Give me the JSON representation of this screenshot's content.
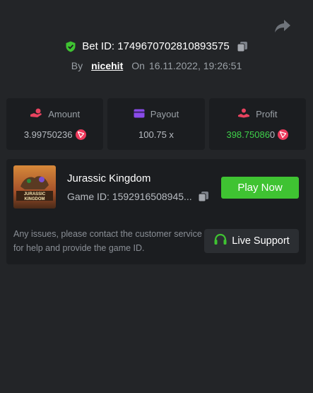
{
  "header": {
    "bet_id_label": "Bet ID:",
    "bet_id": "1749670702810893575",
    "by_label": "By",
    "username": "nicehit",
    "on_label": "On",
    "datetime": "16.11.2022, 19:26:51"
  },
  "stats": {
    "amount": {
      "label": "Amount",
      "value": "3.99750236",
      "icon": "coins-hand-icon",
      "currency_icon": "trx-icon"
    },
    "payout": {
      "label": "Payout",
      "value": "100.75 x",
      "icon": "card-icon"
    },
    "profit": {
      "label": "Profit",
      "value_main": "398.75086",
      "value_tail": "0",
      "icon": "user-hand-icon",
      "currency_icon": "trx-icon"
    }
  },
  "game": {
    "title": "Jurassic Kingdom",
    "id_label": "Game ID:",
    "id_value": "1592916508945...",
    "play_label": "Play Now",
    "thumbnail_text": "JURASSIC KINGDOM"
  },
  "support": {
    "text": "Any issues, please contact the customer service for help and provide the game ID.",
    "button_label": "Live Support"
  },
  "colors": {
    "background": "#232528",
    "card": "#1b1d20",
    "accent_green": "#3fc332",
    "trx_red": "#ee3a5c"
  }
}
